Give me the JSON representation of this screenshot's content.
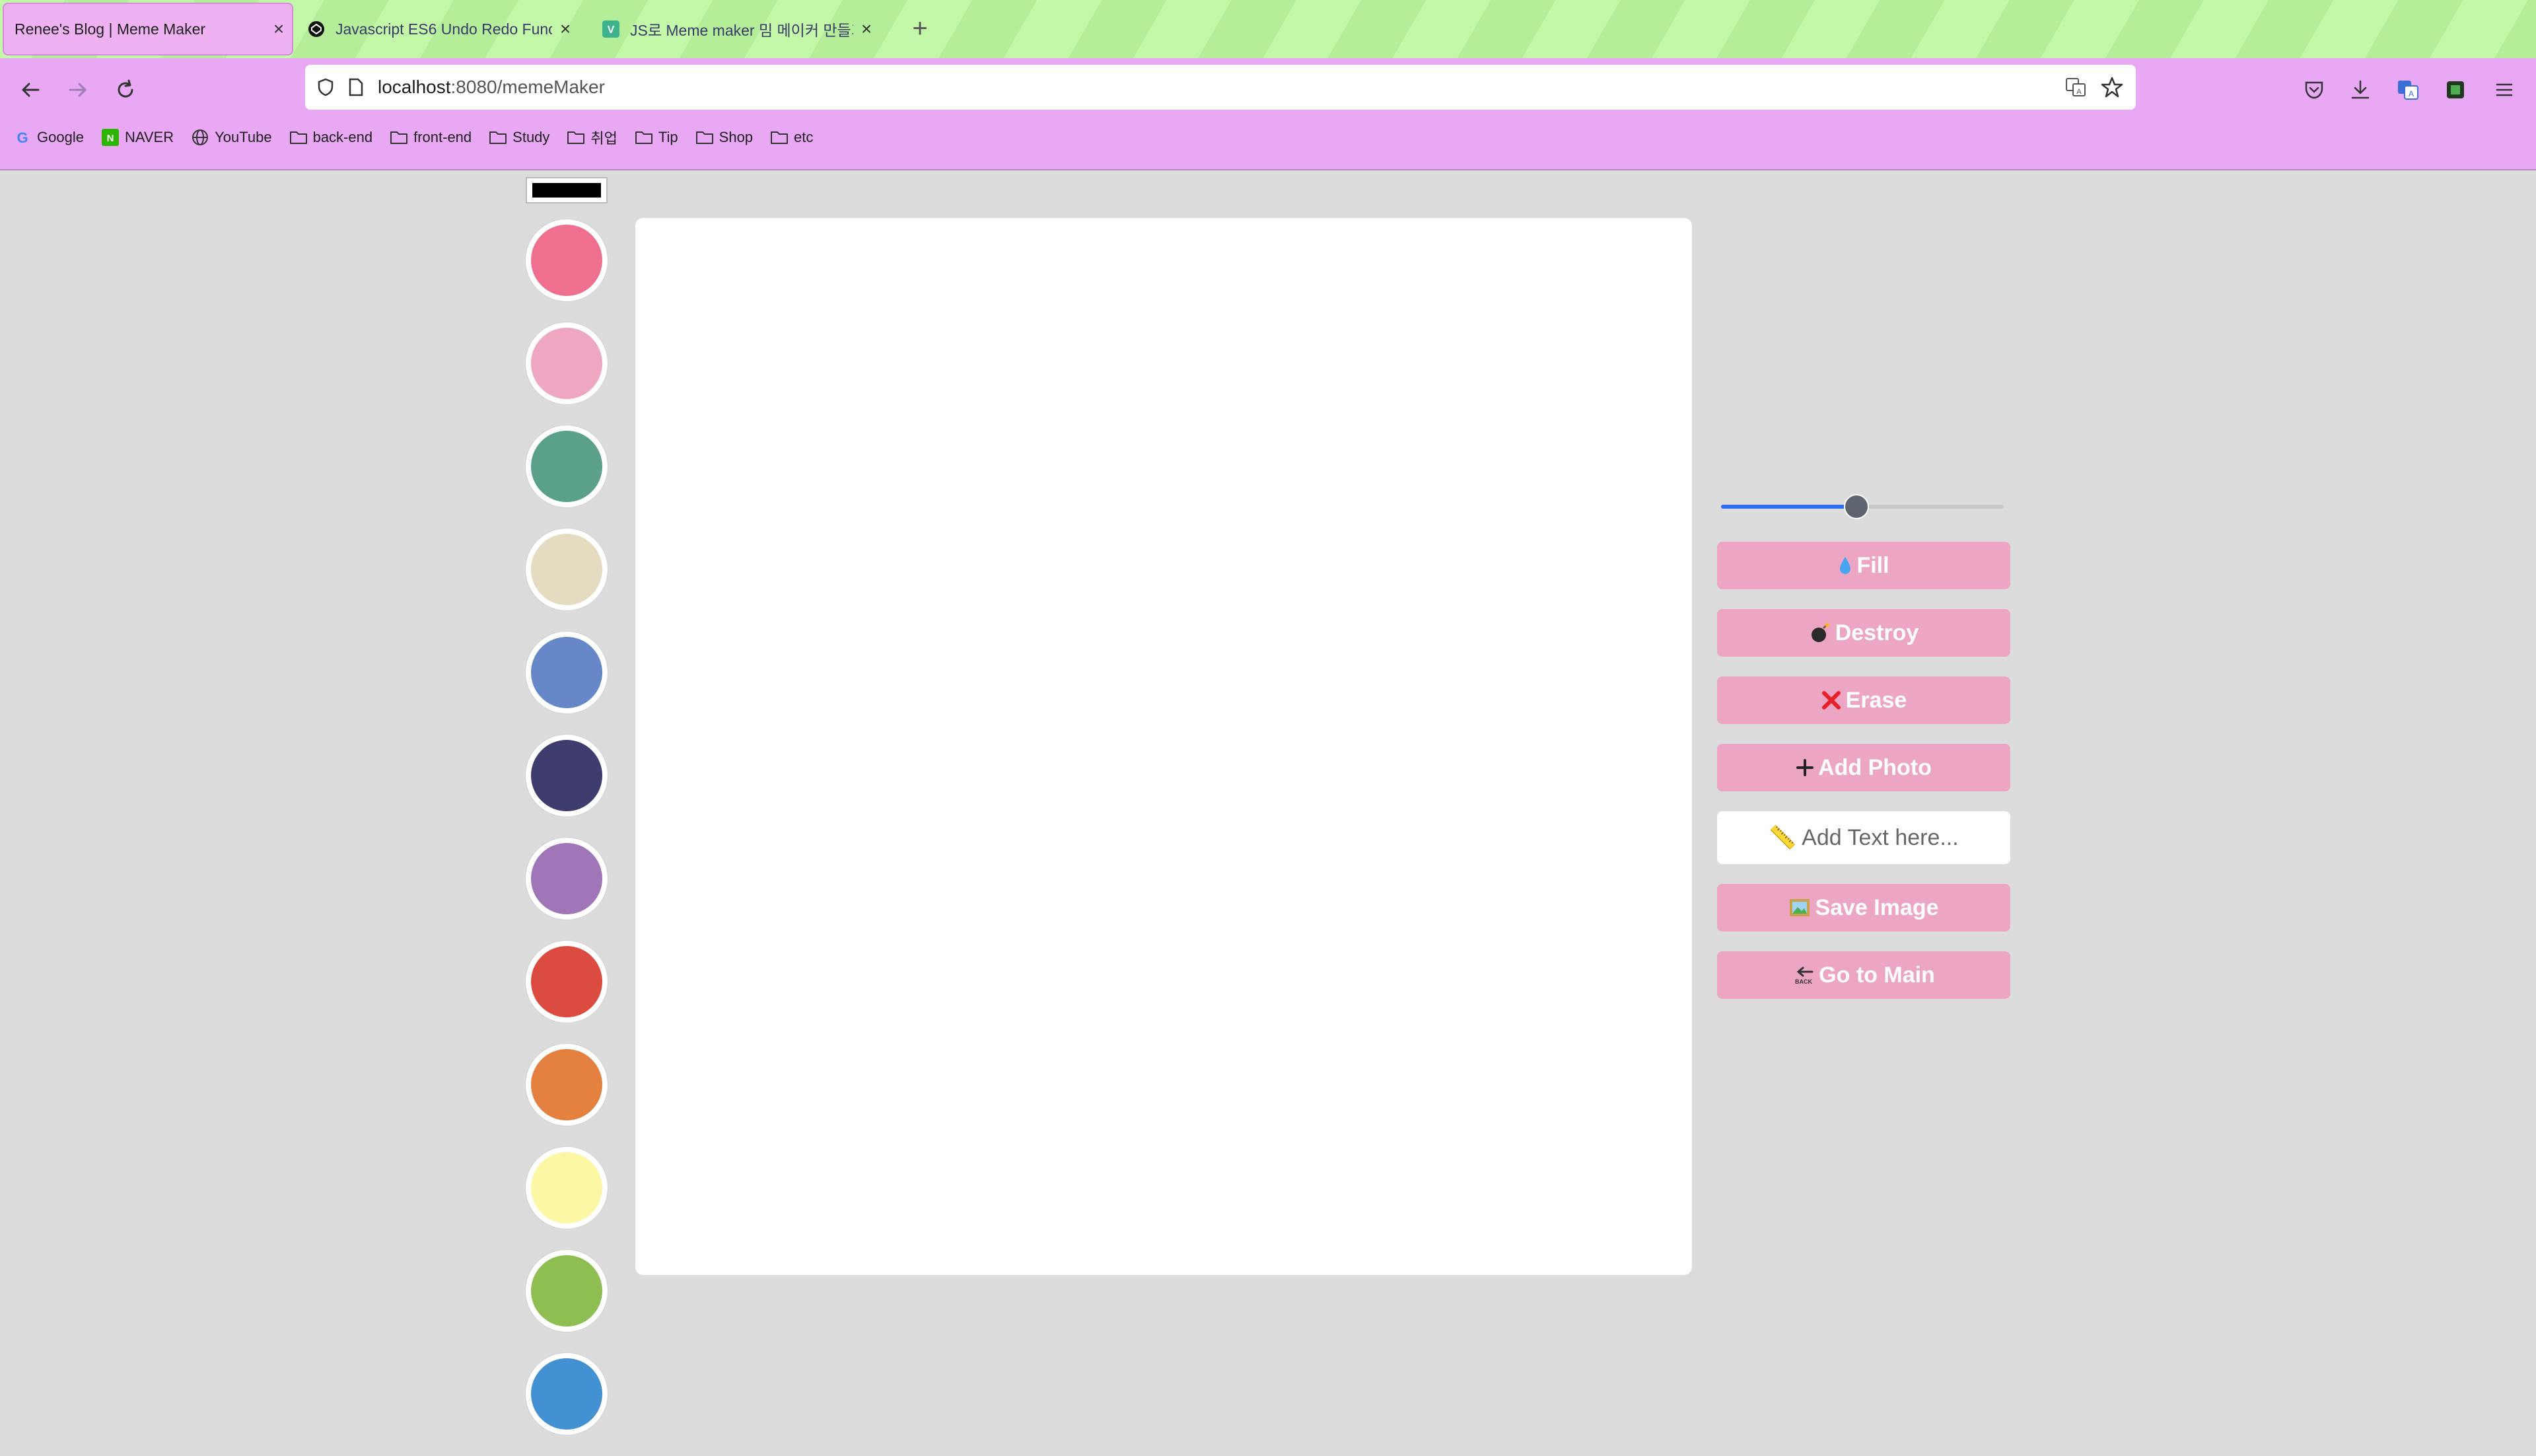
{
  "browser": {
    "tabs": [
      {
        "title": "Renee's Blog | Meme Maker",
        "active": true
      },
      {
        "title": "Javascript ES6 Undo Redo Func",
        "active": false
      },
      {
        "title": "JS로 Meme maker 밈 메이커 만들기",
        "active": false
      }
    ],
    "url_host": "localhost",
    "url_path": ":8080/memeMaker",
    "bookmarks": [
      "Google",
      "NAVER",
      "YouTube",
      "back-end",
      "front-end",
      "Study",
      "취업",
      "Tip",
      "Shop",
      "etc"
    ]
  },
  "palette": {
    "current_color": "#000000",
    "colors": [
      "#ef6f8e",
      "#eea6c3",
      "#5aa08a",
      "#e4dbc0",
      "#6688c8",
      "#3f3d6e",
      "#a076b8",
      "#db4b40",
      "#e58140",
      "#fcf7a4",
      "#8fbe52",
      "#4390d2"
    ]
  },
  "controls": {
    "line_width_fraction": 0.48,
    "fill_label": "Fill",
    "destroy_label": "Destroy",
    "erase_label": "Erase",
    "add_photo_label": "Add Photo",
    "text_placeholder": "📏 Add Text here...",
    "save_label": "Save Image",
    "main_label": "Go to Main"
  }
}
